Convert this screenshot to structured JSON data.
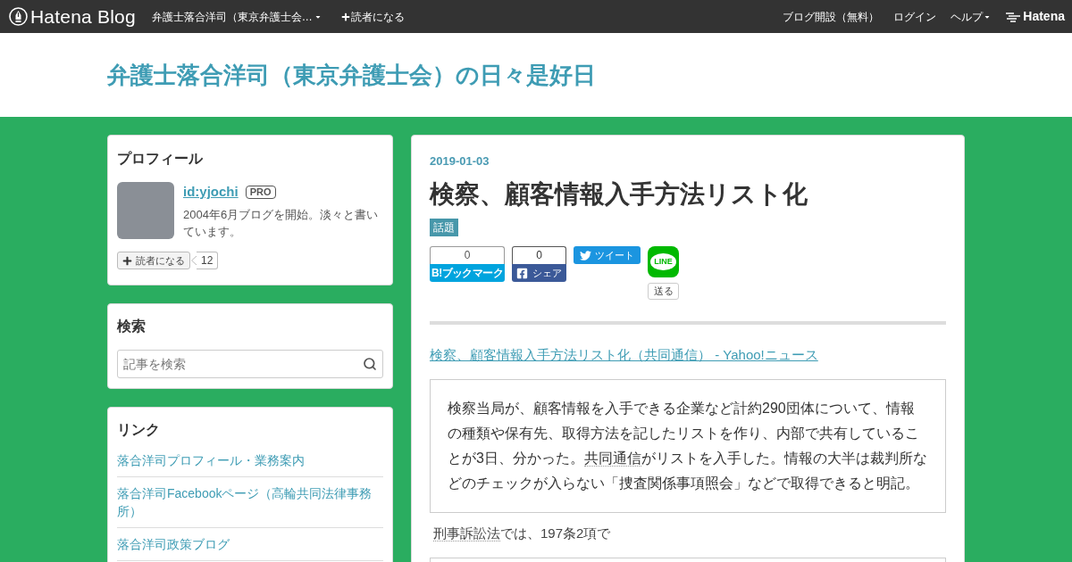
{
  "top_bar": {
    "logo": "Hatena Blog",
    "blog_menu": "弁護士落合洋司（東京弁護士会…",
    "subscribe": "読者になる",
    "right_links": [
      {
        "label": "ブログ開設（無料）",
        "kind": "link"
      },
      {
        "label": "ログイン",
        "kind": "link"
      },
      {
        "label": "ヘルプ",
        "kind": "menu"
      }
    ],
    "brand": "Hatena"
  },
  "header": {
    "title": "弁護士落合洋司（東京弁護士会）の日々是好日"
  },
  "sidebar": {
    "profile": {
      "heading": "プロフィール",
      "user_id": "id:yjochi",
      "badge": "PRO",
      "description": "2004年6月ブログを開始。淡々と書いています。",
      "subscribe_button": "読者になる",
      "subscriber_count": "12"
    },
    "search": {
      "heading": "検索",
      "placeholder": "記事を検索"
    },
    "links": {
      "heading": "リンク",
      "items": [
        "落合洋司プロフィール・業務案内",
        "落合洋司Facebookページ（高輪共同法律事務所）",
        "落合洋司政策ブログ"
      ]
    }
  },
  "article": {
    "date": "2019-01-03",
    "title": "検察、顧客情報入手方法リスト化",
    "categories": [
      "話題"
    ],
    "share": {
      "bookmark_count": "0",
      "bookmark_label": "B!ブックマーク",
      "facebook_count": "0",
      "facebook_label": "シェア",
      "tweet_label": "ツイート",
      "line_logo": "LINE",
      "line_label": "送る"
    },
    "source_link": "検察、顧客情報入手方法リスト化（共同通信） - Yahoo!ニュース",
    "quote": [
      {
        "kind": "text",
        "text": "検察当局が、顧客情報を入手できる企業など計約290団体について、情報の種類や保有先、取得方法を記したリストを作り、内部で共有していることが3日、分かった。"
      },
      {
        "kind": "keyword",
        "text": "共同通信"
      },
      {
        "kind": "text",
        "text": "がリストを入手した。情報の大半は裁判所などのチェックが入らない「捜査関係事項照会」などで取得できると明記。"
      }
    ],
    "paragraph": [
      {
        "kind": "keyword",
        "text": "刑事訴訟法"
      },
      {
        "kind": "text",
        "text": "では、197条2項で"
      }
    ]
  }
}
